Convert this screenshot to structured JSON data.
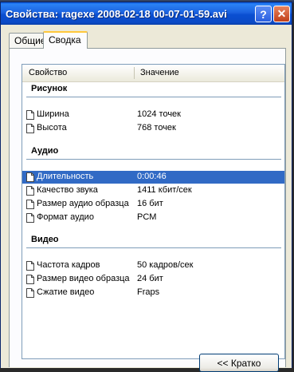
{
  "window": {
    "title": "Свойства: ragexe 2008-02-18 00-07-01-59.avi",
    "help_glyph": "?",
    "close_glyph": "✕"
  },
  "tabs": [
    {
      "label": "Общие",
      "active": false
    },
    {
      "label": "Сводка",
      "active": true
    }
  ],
  "table": {
    "col_property": "Свойство",
    "col_value": "Значение"
  },
  "groups": [
    {
      "name": "Рисунок",
      "rows": [
        {
          "key": "Ширина",
          "value": "1024 точек"
        },
        {
          "key": "Высота",
          "value": "768 точек"
        }
      ]
    },
    {
      "name": "Аудио",
      "rows": [
        {
          "key": "Длительность",
          "value": "0:00:46",
          "selected": true
        },
        {
          "key": "Качество звука",
          "value": "1411 кбит/сек"
        },
        {
          "key": "Размер аудио образца",
          "value": "16 бит"
        },
        {
          "key": "Формат аудио",
          "value": "PCM"
        }
      ]
    },
    {
      "name": "Видео",
      "rows": [
        {
          "key": "Частота кадров",
          "value": "50 кадров/сек"
        },
        {
          "key": "Размер видео образца",
          "value": "24 бит"
        },
        {
          "key": "Сжатие видео",
          "value": "Fraps"
        }
      ]
    }
  ],
  "buttons": {
    "brief": "<< Кратко"
  },
  "colors": {
    "titlebar": "#0a4fd2",
    "selection": "#316ac5",
    "window_bg": "#ece9d8"
  }
}
